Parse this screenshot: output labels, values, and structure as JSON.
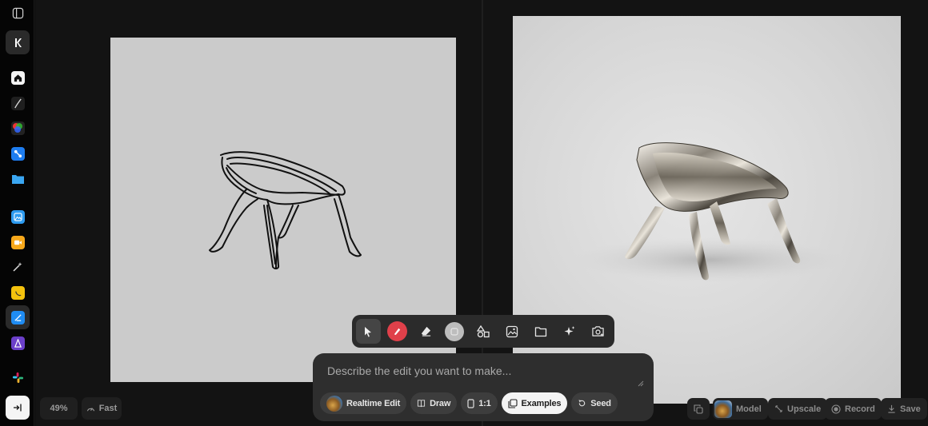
{
  "rail": {
    "items": [
      {
        "name": "sidebar-toggle-icon"
      },
      {
        "name": "krea-logo-icon"
      },
      {
        "name": "home-icon"
      },
      {
        "name": "pen-tool-icon"
      },
      {
        "name": "color-wheel-app-icon"
      },
      {
        "name": "nodes-app-icon"
      },
      {
        "name": "folder-app-icon"
      },
      {
        "name": "image-app-icon"
      },
      {
        "name": "video-app-icon"
      },
      {
        "name": "magic-wand-icon"
      },
      {
        "name": "lipsync-app-icon"
      },
      {
        "name": "realtime-app-icon"
      },
      {
        "name": "train-app-icon"
      },
      {
        "name": "apps-grid-icon"
      },
      {
        "name": "sign-in-icon"
      }
    ]
  },
  "toolbar": {
    "tools": [
      "select-tool",
      "brush-color-tool",
      "eraser-tool",
      "blur-tool",
      "shapes-tool",
      "image-tool",
      "folder-tool",
      "ai-enhance-tool",
      "camera-tool"
    ],
    "brush_color": "#e0404a"
  },
  "prompt": {
    "placeholder": "Describe the edit you want to make..."
  },
  "chips": {
    "realtime_edit": "Realtime Edit",
    "draw": "Draw",
    "aspect": "1:1",
    "examples": "Examples",
    "seed": "Seed"
  },
  "status": {
    "zoom": "49%",
    "speed": "Fast"
  },
  "actions": {
    "model": "Model",
    "upscale": "Upscale",
    "record": "Record",
    "save": "Save"
  },
  "colors": {
    "bg": "#0d0d0d",
    "panel": "#2e2e2e",
    "sketch_bg": "#cbcbcb",
    "accent_red": "#e0404a"
  }
}
